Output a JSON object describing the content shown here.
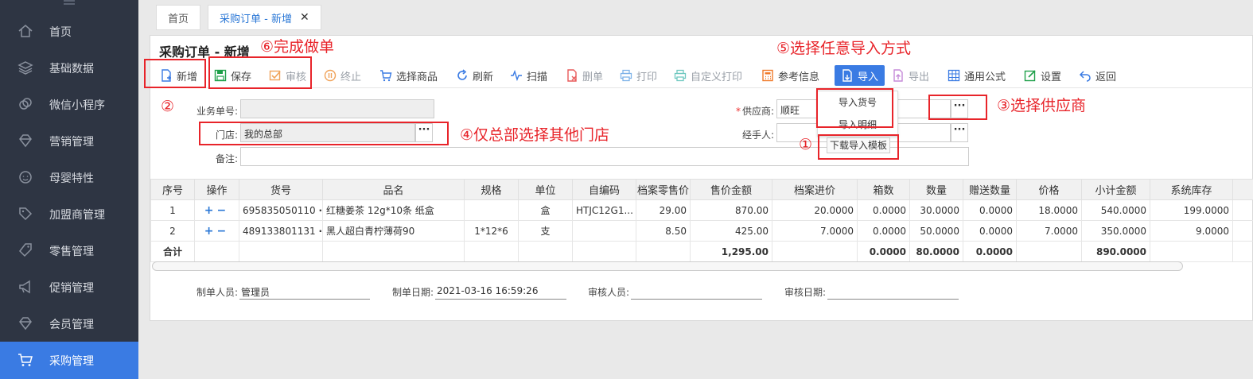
{
  "sidebar": {
    "items": [
      {
        "label": "首页",
        "icon": "home-icon"
      },
      {
        "label": "基础数据",
        "icon": "layers-icon"
      },
      {
        "label": "微信小程序",
        "icon": "link-icon"
      },
      {
        "label": "营销管理",
        "icon": "diamond-icon"
      },
      {
        "label": "母婴特性",
        "icon": "baby-icon"
      },
      {
        "label": "加盟商管理",
        "icon": "tag-icon"
      },
      {
        "label": "零售管理",
        "icon": "price-tag-icon"
      },
      {
        "label": "促销管理",
        "icon": "megaphone-icon"
      },
      {
        "label": "会员管理",
        "icon": "diamond-icon"
      },
      {
        "label": "采购管理",
        "icon": "cart-icon"
      }
    ],
    "active_color": "#3a7be3"
  },
  "tabs": [
    {
      "label": "首页"
    },
    {
      "label": "采购订单 - 新增"
    }
  ],
  "page": {
    "title": "采购订单 - 新增"
  },
  "toolbar": {
    "new": "新增",
    "save": "保存",
    "audit": "审核",
    "stop": "终止",
    "select_goods": "选择商品",
    "refresh": "刷新",
    "scan": "扫描",
    "delete": "删单",
    "print": "打印",
    "custom_print": "自定义打印",
    "reference": "参考信息",
    "import": "导入",
    "export": "导出",
    "formula": "通用公式",
    "settings": "设置",
    "back": "返回"
  },
  "form": {
    "business_no_label": "业务单号:",
    "business_no_value": "",
    "store_label": "门店:",
    "store_value": "我的总部",
    "remark_label": "备注:",
    "remark_value": "",
    "supplier_label": "供应商:",
    "supplier_value": "顺旺",
    "handler_label": "经手人:",
    "handler_value": ""
  },
  "import_menu": {
    "items": [
      "导入货号",
      "导入明细"
    ],
    "download_template": "下载导入模板"
  },
  "table": {
    "headers": [
      "序号",
      "操作",
      "货号",
      "品名",
      "规格",
      "单位",
      "自编码",
      "档案零售价",
      "售价金额",
      "档案进价",
      "箱数",
      "数量",
      "赠送数量",
      "价格",
      "小计金额",
      "系统库存"
    ],
    "rows": [
      {
        "no": "1",
        "code": "695835050110",
        "name": "红糖姜茶 12g*10条 纸盒",
        "spec": "",
        "unit": "盒",
        "selfcode": "HTJC12G1...",
        "retail": "29.00",
        "sale_amt": "870.00",
        "cost": "20.0000",
        "boxes": "0.0000",
        "qty": "30.0000",
        "gift": "0.0000",
        "price": "18.0000",
        "subtotal": "540.0000",
        "stock": "199.0000"
      },
      {
        "no": "2",
        "code": "489133801131",
        "name": "黑人超白青柠薄荷90",
        "spec": "1*12*6",
        "unit": "支",
        "selfcode": "",
        "retail": "8.50",
        "sale_amt": "425.00",
        "cost": "7.0000",
        "boxes": "0.0000",
        "qty": "50.0000",
        "gift": "0.0000",
        "price": "7.0000",
        "subtotal": "350.0000",
        "stock": "9.0000"
      }
    ],
    "total": {
      "label": "合计",
      "sale_amt": "1,295.00",
      "boxes": "0.0000",
      "qty": "80.0000",
      "gift": "0.0000",
      "subtotal": "890.0000"
    }
  },
  "footer": {
    "maker_label": "制单人员:",
    "maker_value": "管理员",
    "date_label": "制单日期:",
    "date_value": "2021-03-16 16:59:26",
    "auditor_label": "审核人员:",
    "auditor_value": "",
    "audit_date_label": "审核日期:",
    "audit_date_value": ""
  },
  "annotations": {
    "a1": "①",
    "a2": "②",
    "a3": "③选择供应商",
    "a4": "④仅总部选择其他门店",
    "a5": "⑤选择任意导入方式",
    "a6": "⑥完成做单",
    "color": "#e8242a"
  }
}
